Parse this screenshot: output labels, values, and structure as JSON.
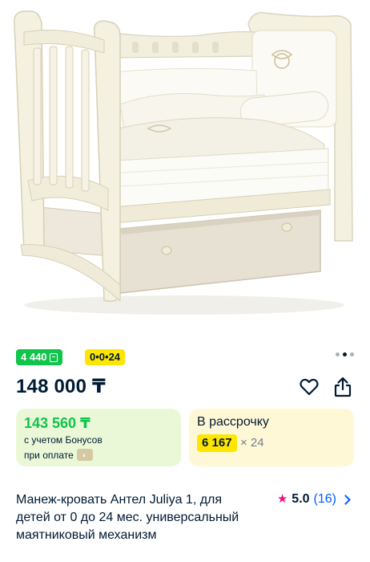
{
  "gallery": {
    "image_alt": "Манеж-кровать Антел Juliya 1",
    "pager_total": 3,
    "pager_active": 1
  },
  "badges": {
    "bonus_points": "4 440",
    "installment_tag": "0•0•24"
  },
  "price": {
    "main": "148 000 ₸"
  },
  "ozon_card": {
    "price": "143 560 ₸",
    "line1": "с учетом Бонусов",
    "line2": "при оплате"
  },
  "installment_card": {
    "title": "В рассрочку",
    "amount": "6 167",
    "multiplier": "× 24"
  },
  "product": {
    "title": "Манеж-кровать Антел Juliya 1, для детей от 0 до 24 мес. универсальный маятниковый механизм"
  },
  "rating": {
    "value": "5.0",
    "count": "(16)"
  },
  "colors": {
    "bonus_green": "#10c44c",
    "accent_yellow": "#ffe600",
    "ozon_card_bg": "#eaf8d7",
    "installment_card_bg": "#fff8d7",
    "link_blue": "#005bff",
    "star_pink": "#f1117e",
    "text_dark": "#001a34"
  },
  "icons": [
    "bonus-coin-icon",
    "favorite-heart-icon",
    "share-icon",
    "ozon-pay-icon",
    "star-icon",
    "chevron-right-icon"
  ]
}
